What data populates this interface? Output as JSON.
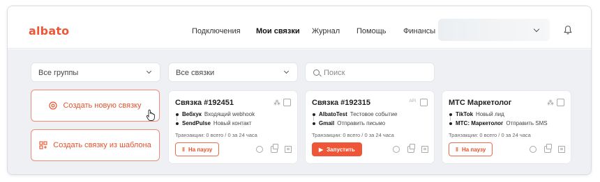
{
  "header": {
    "logo": "albato",
    "nav": [
      "Подключения",
      "Мои связки",
      "Журнал",
      "Помощь",
      "Финансы"
    ],
    "active_nav": "Мои связки"
  },
  "filters": {
    "groups_select": "Все группы",
    "bundles_select": "Все связки",
    "search_placeholder": "Поиск"
  },
  "actions": {
    "create_new": "Создать новую связку",
    "create_from_template": "Создать связку из шаблона"
  },
  "cards": [
    {
      "title": "Связка #192451",
      "steps": [
        {
          "app": "Вебхук",
          "event": "Входящий webhook"
        },
        {
          "app": "SendPulse",
          "event": "Новый контакт"
        }
      ],
      "transactions": "Транзакции: 0 всего / 0 за 24 часа",
      "button": "На паузу",
      "tag": ""
    },
    {
      "title": "Связка #192315",
      "steps": [
        {
          "app": "AlbatoTest",
          "event": "Тестовое событие"
        },
        {
          "app": "Gmail",
          "event": "Отправить письмо"
        }
      ],
      "transactions": "Транзакции: 0 всего / 0 за 24 часа",
      "button": "Запустить",
      "tag": "API"
    },
    {
      "title": "МТС Маркетолог",
      "steps": [
        {
          "app": "TikTok",
          "event": "Новый лид"
        },
        {
          "app": "МТС: Маркетолог",
          "event": "Отправить SMS"
        }
      ],
      "transactions": "Транзакции: 0 всего / 0 за 24 часа",
      "button": "На паузу",
      "tag": ""
    }
  ],
  "colors": {
    "accent": "#ef5637",
    "background": "#eef0f3"
  }
}
